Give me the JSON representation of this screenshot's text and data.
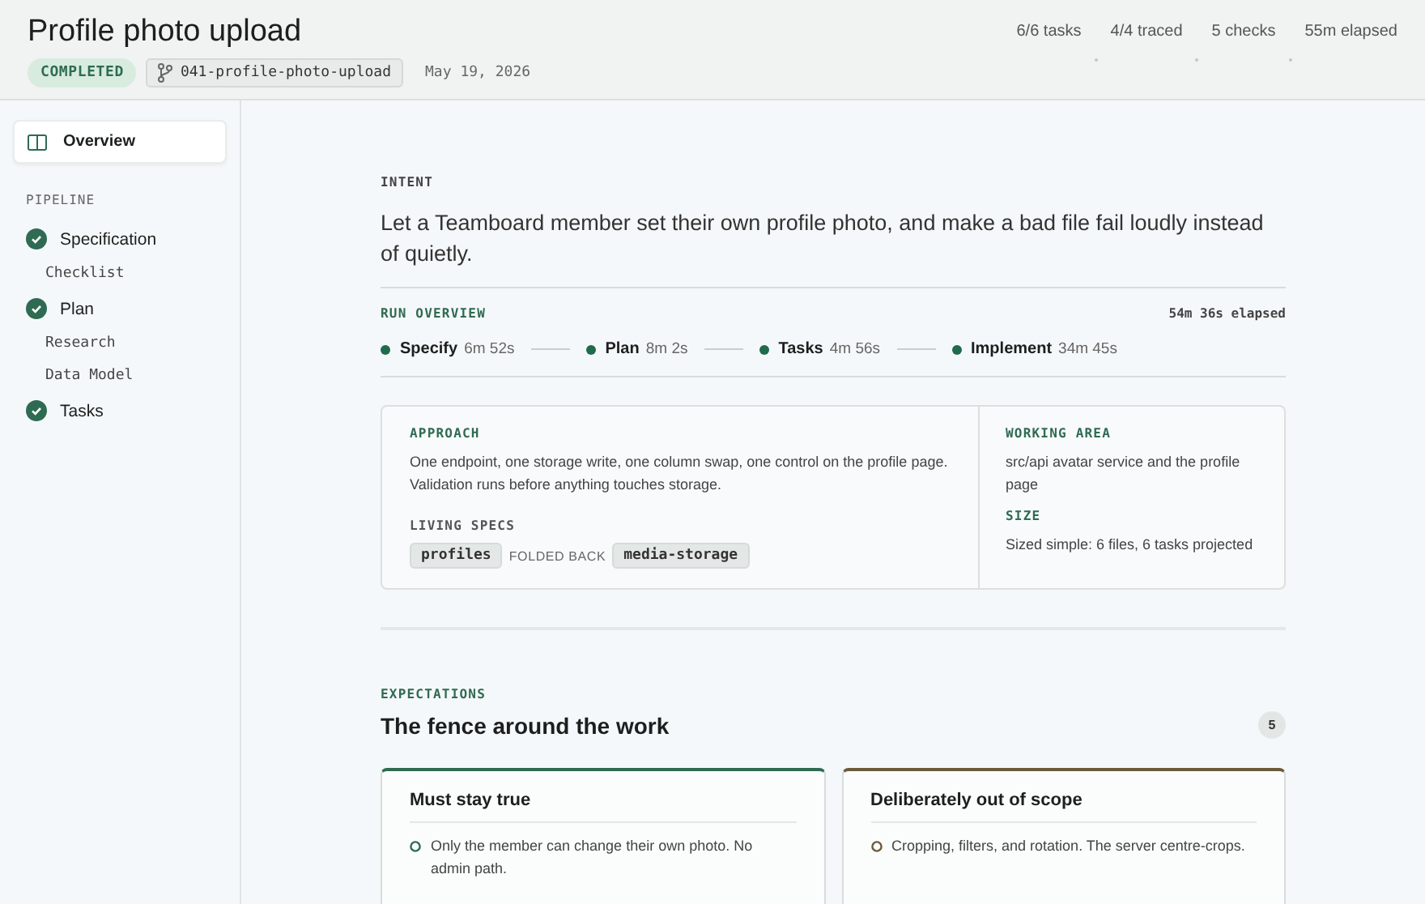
{
  "header": {
    "title": "Profile photo upload",
    "status": "COMPLETED",
    "branch": "041-profile-photo-upload",
    "date": "May 19, 2026",
    "stats": [
      "6/6 tasks",
      "4/4 traced",
      "5 checks",
      "55m elapsed"
    ]
  },
  "sidebar": {
    "overview": {
      "label": "Overview",
      "selected": true
    },
    "section": "PIPELINE",
    "items": [
      {
        "label": "Specification",
        "done": true,
        "children": [
          {
            "label": "Checklist"
          }
        ]
      },
      {
        "label": "Plan",
        "done": true,
        "children": [
          {
            "label": "Research"
          },
          {
            "label": "Data Model"
          }
        ]
      },
      {
        "label": "Tasks",
        "done": true
      }
    ]
  },
  "intent": {
    "label": "INTENT",
    "text": "Let a Teamboard member set their own profile photo, and make a bad file fail loudly instead of quietly."
  },
  "run_overview": {
    "label": "RUN OVERVIEW",
    "elapsed": "54m 36s elapsed",
    "stages": [
      {
        "name": "Specify",
        "time": "6m 52s",
        "done": true
      },
      {
        "name": "Plan",
        "time": "8m 2s",
        "done": true
      },
      {
        "name": "Tasks",
        "time": "4m 56s",
        "done": true
      },
      {
        "name": "Implement",
        "time": "34m 45s",
        "done": true
      }
    ]
  },
  "approach": {
    "label": "APPROACH",
    "text": "One endpoint, one storage write, one column swap, one control on the profile page. Validation runs before anything touches storage.",
    "specs_label": "LIVING SPECS",
    "specs": [
      "profiles",
      "media-storage"
    ],
    "specs_between": "FOLDED BACK"
  },
  "working_area": {
    "label": "WORKING AREA",
    "text": "src/api avatar service and the profile page",
    "size_label": "SIZE",
    "size_text": "Sized simple: 6 files, 6 tasks projected"
  },
  "expectations": {
    "label": "EXPECTATIONS",
    "title": "The fence around the work",
    "count": "5",
    "cards": [
      {
        "title": "Must stay true",
        "color": "#2f6b52",
        "items": [
          "Only the member can change their own photo. No admin path."
        ]
      },
      {
        "title": "Deliberately out of scope",
        "color": "#6b5a3a",
        "items": [
          "Cropping, filters, and rotation. The server centre-crops."
        ]
      }
    ]
  }
}
